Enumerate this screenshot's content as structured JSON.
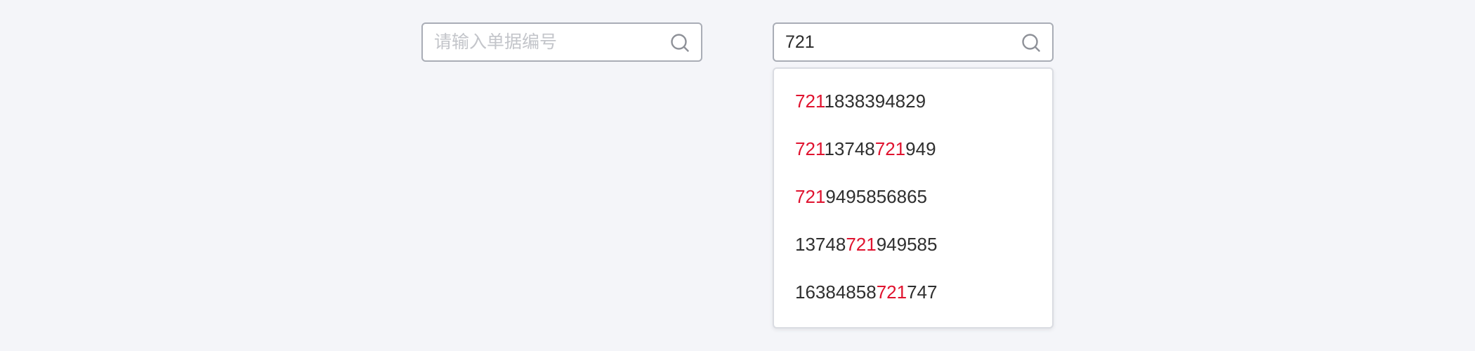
{
  "search_empty": {
    "placeholder": "请输入单据编号",
    "value": "",
    "icon": "search-icon"
  },
  "search_filled": {
    "placeholder": "请输入单据编号",
    "value": "721",
    "icon": "search-icon"
  },
  "highlight_color": "#e0132f",
  "suggestions": [
    "7211838394829",
    "72113748721949",
    "7219495856865",
    "13748721949585",
    "16384858721747"
  ]
}
